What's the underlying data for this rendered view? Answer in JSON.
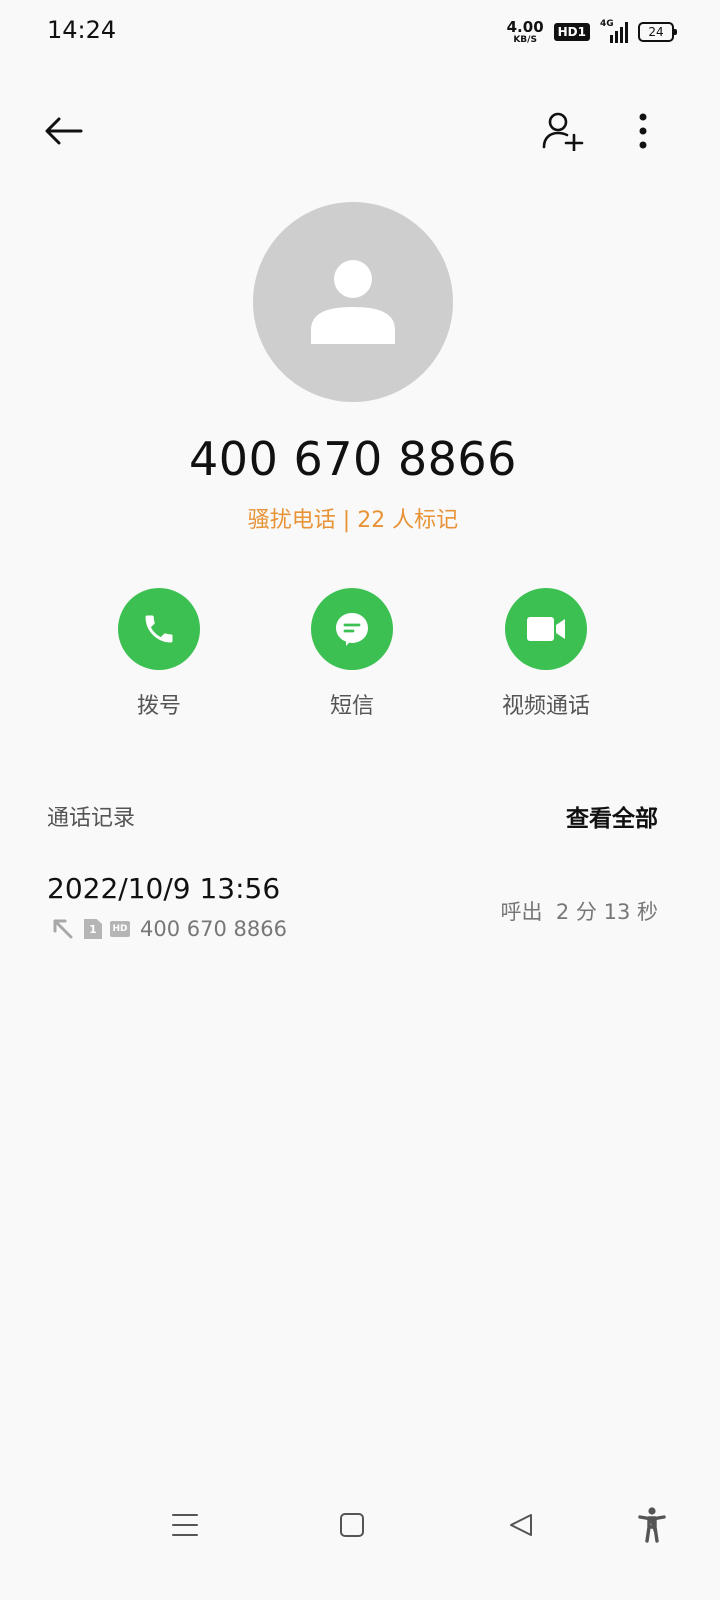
{
  "status_bar": {
    "time": "14:24",
    "speed_value": "4.00",
    "speed_unit": "KB/S",
    "hd_label": "HD1",
    "network_label": "4G",
    "battery_level": "24"
  },
  "header": {
    "back_icon": "arrow-left-icon",
    "add_contact_icon": "person-add-icon",
    "more_icon": "more-vertical-icon"
  },
  "contact": {
    "avatar_icon": "person-placeholder-icon",
    "phone_number": "400 670 8866",
    "tag_line": "骚扰电话 | 22 人标记",
    "tag_color": "#e89337"
  },
  "actions": {
    "call_label": "拨号",
    "sms_label": "短信",
    "video_label": "视频通话",
    "accent_color": "#3cc051"
  },
  "call_log": {
    "section_title": "通话记录",
    "view_all_label": "查看全部",
    "entries": [
      {
        "datetime": "2022/10/9 13:56",
        "direction_icon": "outgoing-arrow-icon",
        "sim_label": "1",
        "hd_label": "HD",
        "number": "400 670 8866",
        "type_duration": "呼出  2 分 13 秒"
      }
    ]
  },
  "nav_bar": {
    "menu_icon": "menu-icon",
    "home_icon": "home-square-icon",
    "back_icon": "back-triangle-icon",
    "accessibility_icon": "accessibility-icon"
  }
}
